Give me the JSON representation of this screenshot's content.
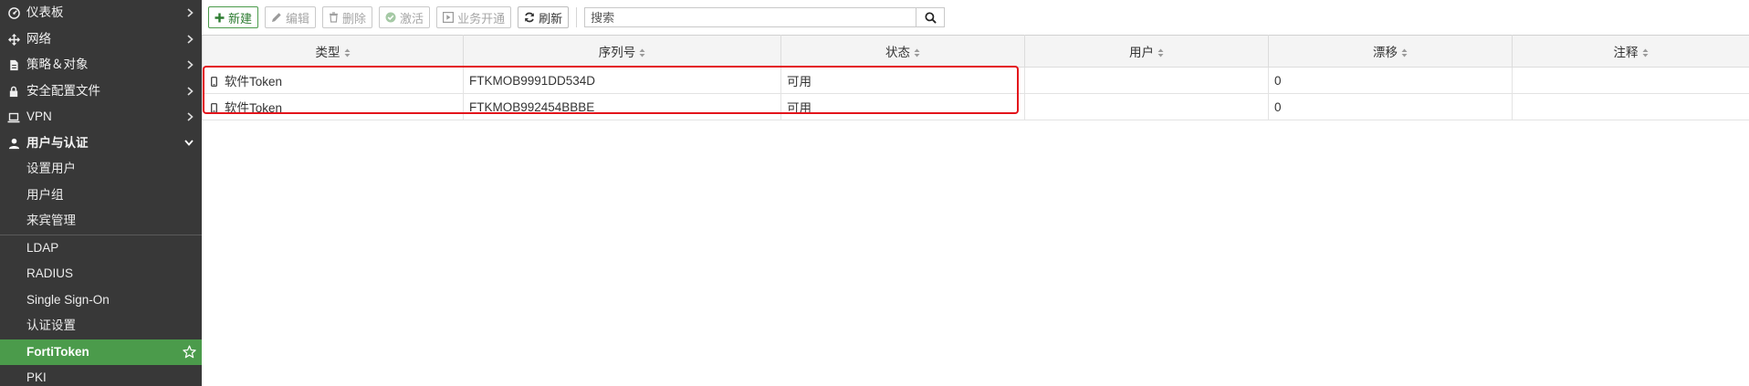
{
  "sidebar": {
    "items": [
      {
        "label": "仪表板",
        "icon": "dashboard-icon"
      },
      {
        "label": "网络",
        "icon": "network-move-icon"
      },
      {
        "label": "策略＆对象",
        "icon": "policy-icon"
      },
      {
        "label": "安全配置文件",
        "icon": "lock-icon"
      },
      {
        "label": "VPN",
        "icon": "laptop-icon"
      },
      {
        "label": "用户与认证",
        "icon": "user-icon"
      }
    ],
    "sub_items": [
      {
        "label": "设置用户"
      },
      {
        "label": "用户组"
      },
      {
        "label": "来宾管理"
      },
      {
        "label": "LDAP"
      },
      {
        "label": "RADIUS"
      },
      {
        "label": "Single Sign-On"
      },
      {
        "label": "认证设置"
      },
      {
        "label": "FortiToken"
      },
      {
        "label": "PKI"
      }
    ],
    "active_item": "FortiToken",
    "active_color": "#4b9b4b"
  },
  "toolbar": {
    "new_label": "新建",
    "edit_label": "编辑",
    "delete_label": "删除",
    "activate_label": "激活",
    "provision_label": "业务开通",
    "refresh_label": "刷新",
    "search_placeholder": "搜索"
  },
  "table": {
    "columns": [
      "类型",
      "序列号",
      "状态",
      "用户",
      "漂移",
      "注释"
    ],
    "rows": [
      {
        "type": "软件Token",
        "serial": "FTKMOB9991DD534D",
        "status": "可用",
        "user": "",
        "drift": "0",
        "comment": ""
      },
      {
        "type": "软件Token",
        "serial": "FTKMOB992454BBBE",
        "status": "可用",
        "user": "",
        "drift": "0",
        "comment": ""
      }
    ]
  },
  "colors": {
    "sidebar_bg": "#383838",
    "highlight_border": "#e3141b",
    "primary_green": "#4b9b4b"
  }
}
